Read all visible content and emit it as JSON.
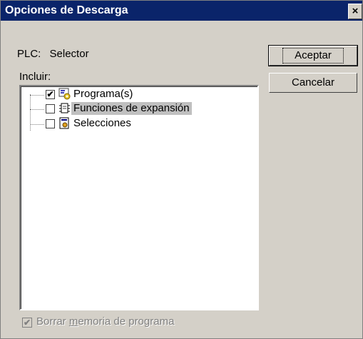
{
  "window": {
    "title": "Opciones de Descarga",
    "close_glyph": "×"
  },
  "plc": {
    "label": "PLC:",
    "value": "Selector"
  },
  "include_label": "Incluir:",
  "tree": {
    "items": [
      {
        "label": "Programa(s)",
        "checked": true,
        "check_glyph": "✔",
        "icon": "program-icon"
      },
      {
        "label": "Funciones de expansión",
        "checked": false,
        "check_glyph": "",
        "icon": "expansion-functions-icon",
        "highlighted": true
      },
      {
        "label": "Selecciones",
        "checked": false,
        "check_glyph": "",
        "icon": "selections-icon"
      }
    ]
  },
  "buttons": {
    "accept": "Aceptar",
    "cancel": "Cancelar"
  },
  "erase_memory": {
    "pre": "Borrar ",
    "mnemonic": "m",
    "post": "emoria de programa",
    "checked": true,
    "check_glyph": "✔",
    "enabled": false
  }
}
